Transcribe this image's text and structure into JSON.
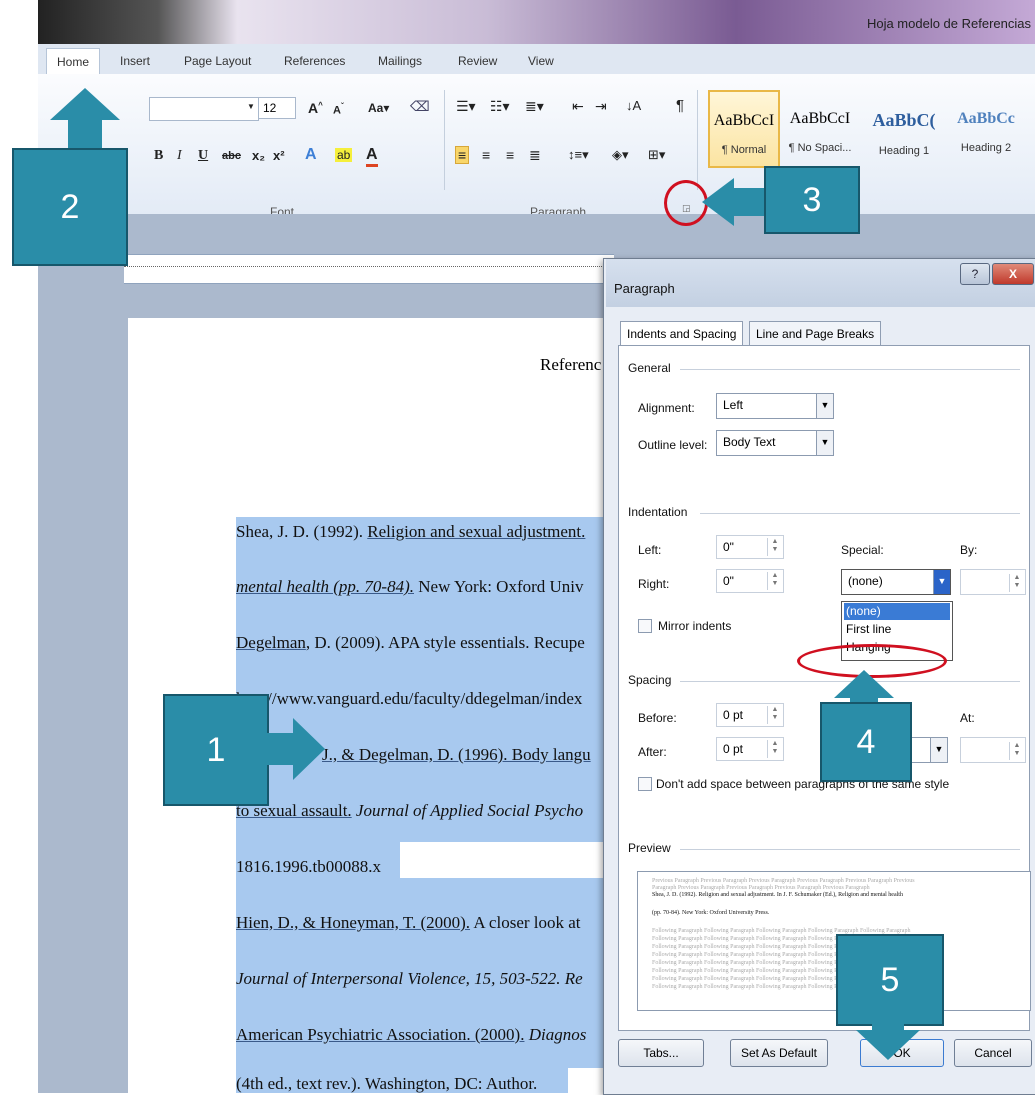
{
  "window": {
    "title": "Hoja modelo de Referencias"
  },
  "ribbon": {
    "tabs": [
      "Home",
      "Insert",
      "Page Layout",
      "References",
      "Mailings",
      "Review",
      "View"
    ],
    "font_size": "12",
    "groups": {
      "font": "Font",
      "paragraph": "Paragraph"
    },
    "styles": [
      {
        "sample": "AaBbCcI",
        "name": "¶ Normal"
      },
      {
        "sample": "AaBbCcI",
        "name": "¶ No Spaci..."
      },
      {
        "sample": "AaBbC(",
        "name": "Heading 1"
      },
      {
        "sample": "AaBbCc",
        "name": "Heading 2"
      }
    ]
  },
  "document": {
    "title_fragment": "Referenc",
    "lines": [
      {
        "a": "Shea, J. D. (1992). ",
        "b": "Religion and sexual adjustment.",
        "c": ""
      },
      {
        "a": "",
        "b": "mental health (pp. 70-84).",
        "c": " New York: Oxford Univ"
      },
      {
        "a": "",
        "b": "Degelman",
        "c": ", D. (2009). APA style essentials. Recupe"
      },
      {
        "a": "",
        "b": "",
        "c": "http://www.vanguard.edu/faculty/ddegelman/index"
      },
      {
        "a": "",
        "b": "",
        "c": "J., & Degelman, D. (1996). Body langu"
      },
      {
        "a": "",
        "b": "to sexual assault.",
        "c": " Journal of Applied Social Psycho"
      },
      {
        "a": "",
        "b": "",
        "c": "1816.1996.tb00088.x"
      },
      {
        "a": "",
        "b": "Hien, D., & Honeyman, T. (2000).",
        "c": " A closer look at"
      },
      {
        "a": "",
        "b": "",
        "c": "Journal of Interpersonal Violence, 15, 503-522. Re"
      },
      {
        "a": "",
        "b": "American Psychiatric Association. (2000).",
        "c": " Diagnos"
      },
      {
        "a": "",
        "b": "",
        "c": "(4th ed., text rev.). Washington, DC: Author."
      }
    ]
  },
  "dialog": {
    "title": "Paragraph",
    "tabs": [
      "Indents and Spacing",
      "Line and Page Breaks"
    ],
    "general": {
      "section": "General",
      "alignment_label": "Alignment:",
      "alignment_value": "Left",
      "outline_label": "Outline level:",
      "outline_value": "Body Text"
    },
    "indentation": {
      "section": "Indentation",
      "left_label": "Left:",
      "left_value": "0\"",
      "right_label": "Right:",
      "right_value": "0\"",
      "special_label": "Special:",
      "special_value": "(none)",
      "by_label": "By:",
      "mirror_label": "Mirror indents",
      "options": [
        "(none)",
        "First line",
        "Hanging"
      ]
    },
    "spacing": {
      "section": "Spacing",
      "before_label": "Before:",
      "before_value": "0 pt",
      "after_label": "After:",
      "after_value": "0 pt",
      "at_label": "At:",
      "dont_add_label": "Don't add space between paragraphs of the same style"
    },
    "preview": {
      "section": "Preview",
      "prev_text_1": "Previous Paragraph Previous Paragraph Previous Paragraph Previous Paragraph Previous Paragraph Previous",
      "prev_text_2": "Paragraph Previous Paragraph Previous Paragraph Previous Paragraph Previous Paragraph",
      "sample_1": "Shea, J. D. (1992). Religion and sexual adjustment. In J. F. Schumaker (Ed.), Religion and mental health",
      "sample_2": "(pp. 70-84). New York: Oxford University Press.",
      "follow_text": "Following Paragraph Following Paragraph Following Paragraph Following Paragraph Following Paragraph"
    },
    "buttons": {
      "tabs": "Tabs...",
      "default": "Set As Default",
      "ok": "OK",
      "cancel": "Cancel"
    },
    "help_glyph": "?",
    "close_glyph": "X"
  },
  "annotations": [
    "1",
    "2",
    "3",
    "4",
    "5"
  ]
}
